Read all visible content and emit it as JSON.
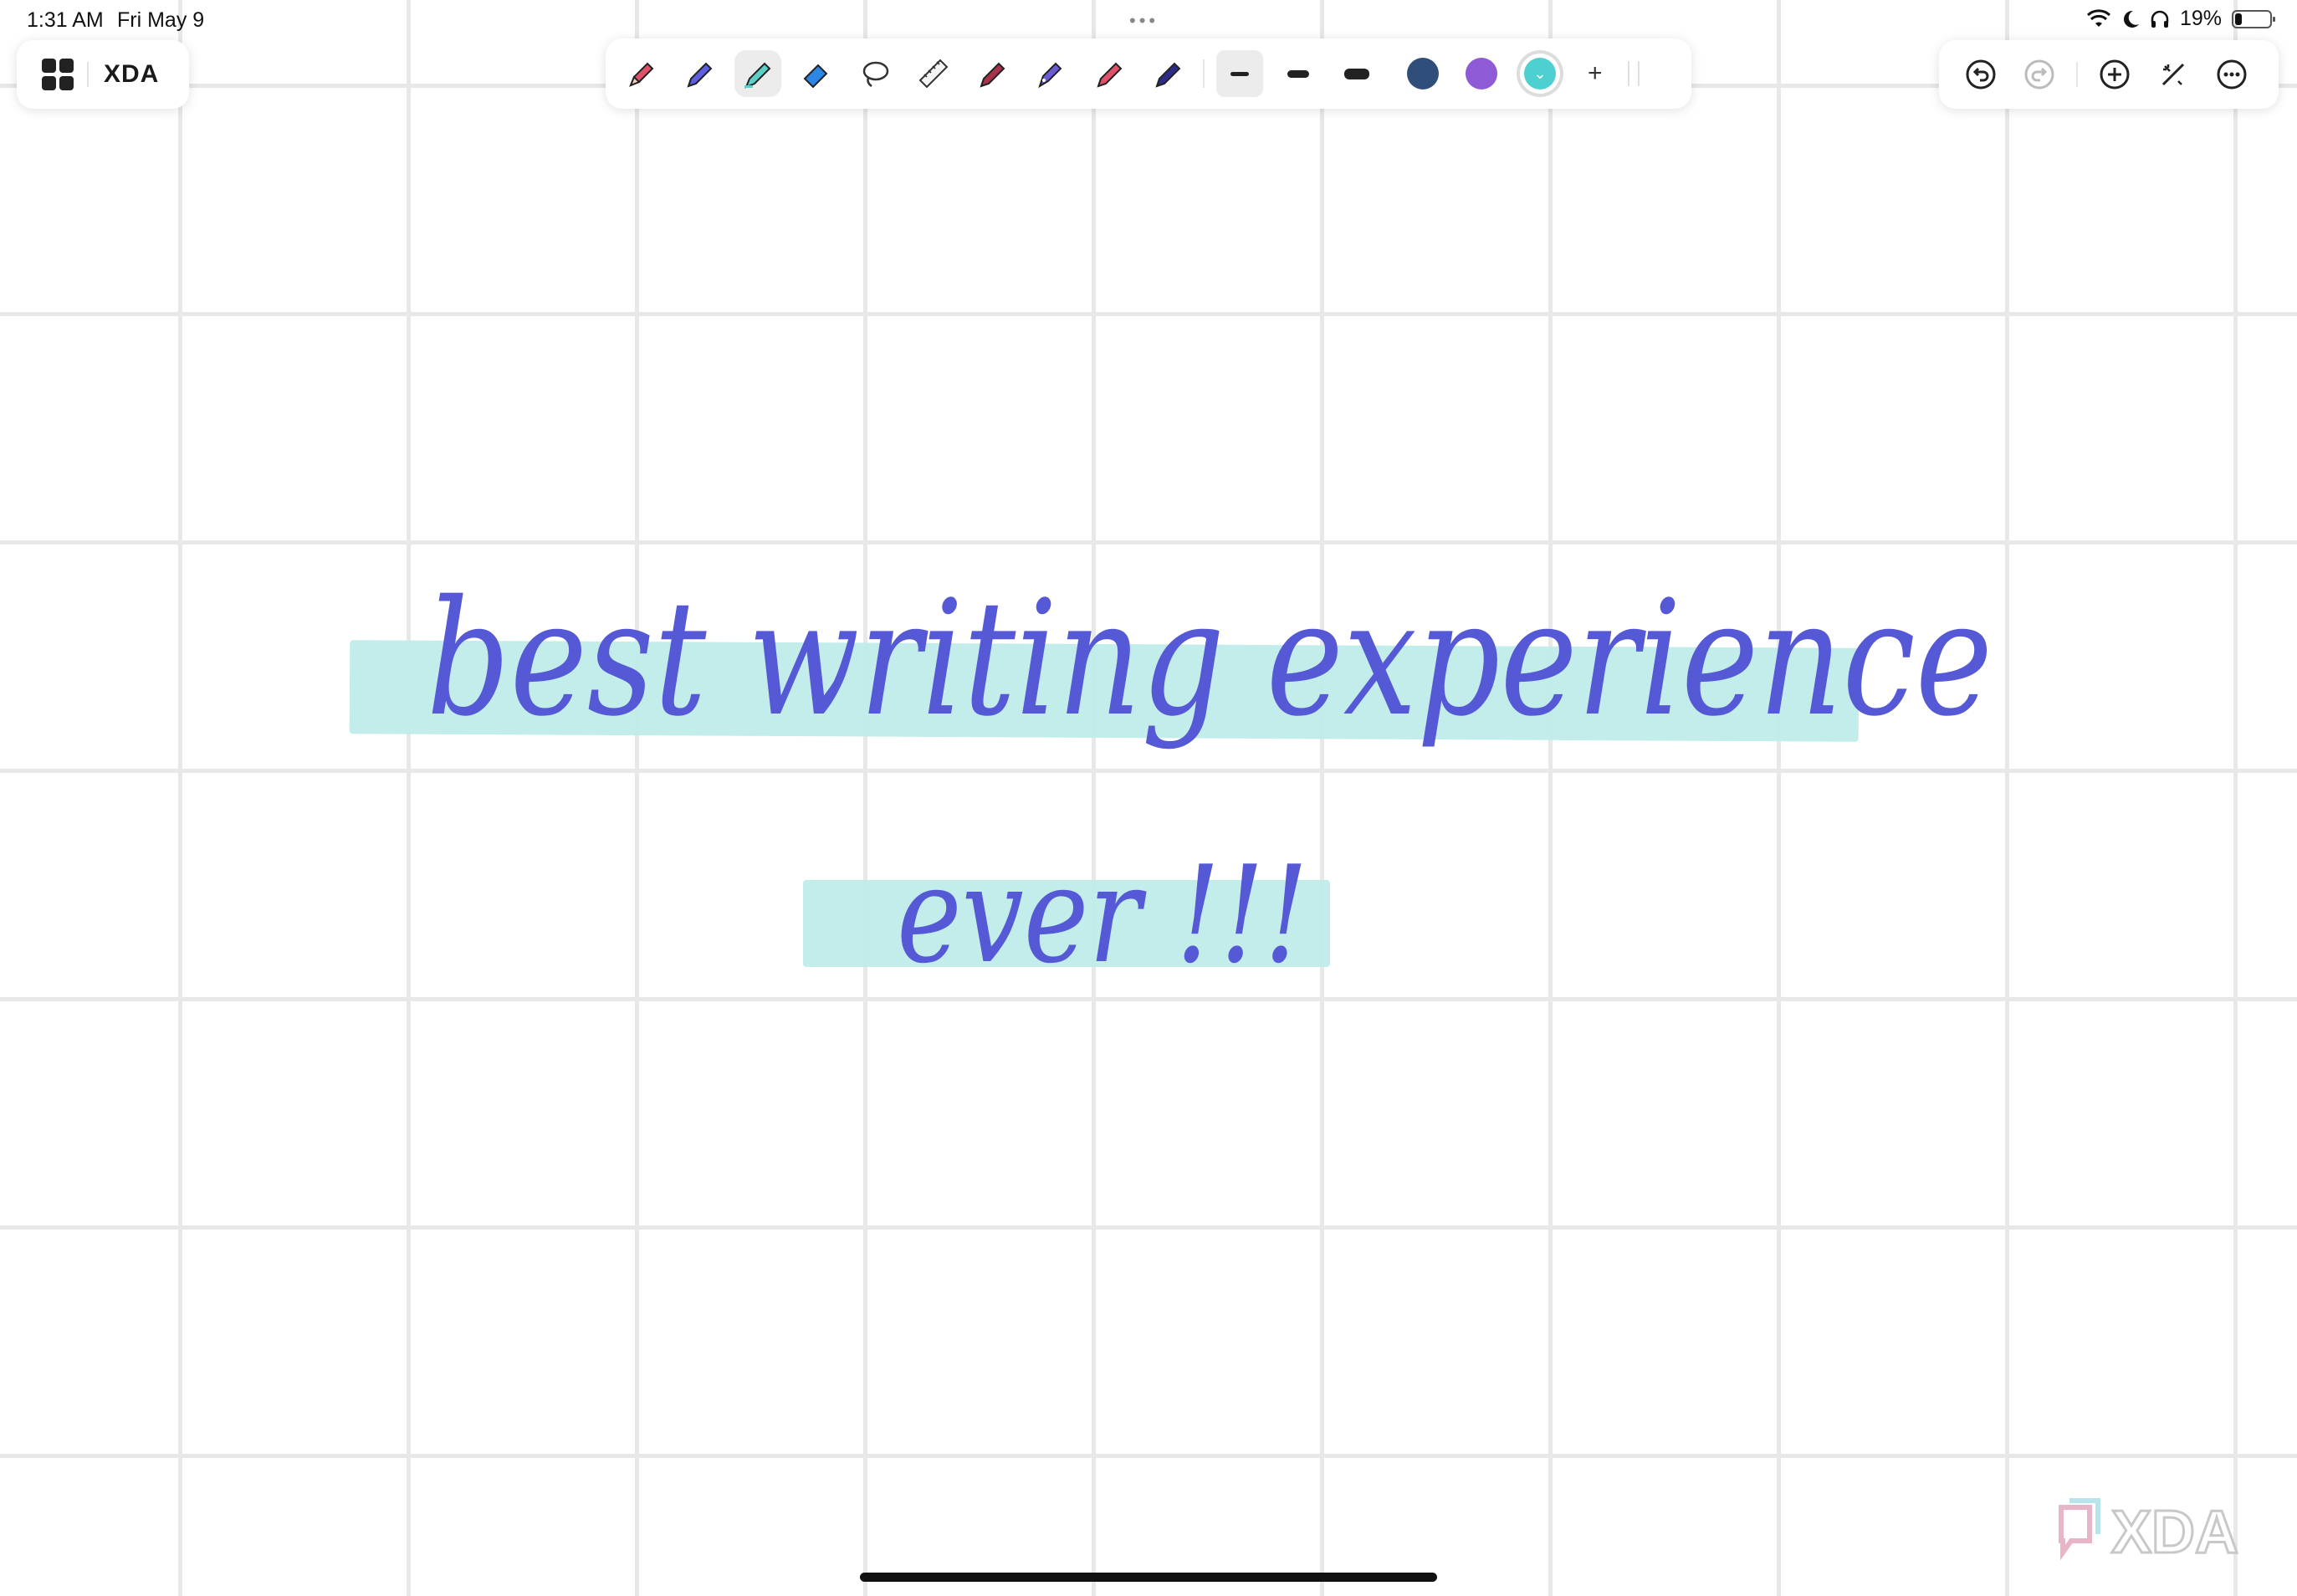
{
  "status_bar": {
    "time": "1:31 AM",
    "date": "Fri May 9",
    "battery_text": "19%",
    "battery_level": 0.19,
    "icons": [
      "wifi-icon",
      "moon-icon",
      "headphones-icon",
      "battery-icon"
    ]
  },
  "top_left": {
    "grid_icon": "app-grid-icon",
    "logo_text": "XDA"
  },
  "toolbar": {
    "tools": [
      {
        "name": "pencil-icon",
        "color": "#e0506a"
      },
      {
        "name": "pen-icon",
        "color": "#5b5fe0"
      },
      {
        "name": "highlighter-icon",
        "color": "#5ad0c6",
        "active": true
      },
      {
        "name": "eraser-icon",
        "color": "#2b86e6"
      },
      {
        "name": "lasso-icon",
        "color": "#333333"
      },
      {
        "name": "ruler-icon",
        "color": "#333333"
      },
      {
        "name": "marker-icon",
        "color": "#a8324a"
      },
      {
        "name": "fountain-pen-icon",
        "color": "#6a5bd6"
      },
      {
        "name": "brush-icon",
        "color": "#e0506a"
      },
      {
        "name": "calligraphy-pen-icon",
        "color": "#2d2a8a"
      }
    ],
    "stroke_sizes": [
      "thin",
      "medium",
      "thick"
    ],
    "swatches": [
      "#2f4f7a",
      "#8e5ad6",
      "#4ecfd0"
    ],
    "selected_swatch": "#4ecfd0"
  },
  "top_right": {
    "buttons": [
      "undo-icon",
      "redo-icon",
      "add-icon",
      "magic-pen-icon",
      "more-icon"
    ]
  },
  "canvas": {
    "line1": "best writing experience",
    "line2": "ever !!!",
    "ink_color": "#5559d6",
    "highlight_color": "#bfece9"
  },
  "watermark": "XDA"
}
